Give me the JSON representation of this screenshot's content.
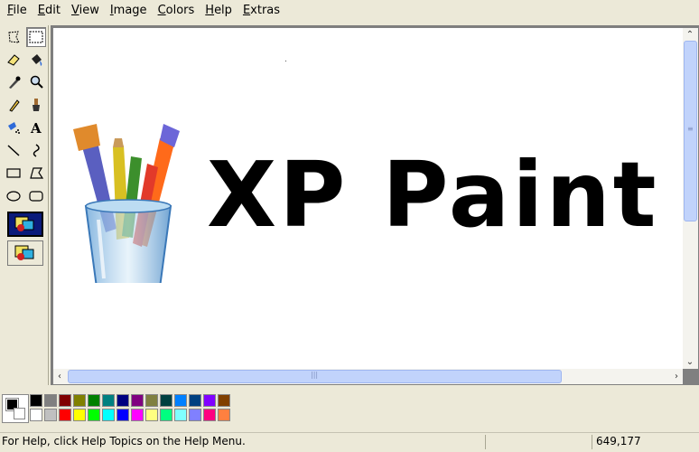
{
  "menu": [
    {
      "label": "File",
      "accel": "F",
      "rest": "ile"
    },
    {
      "label": "Edit",
      "accel": "E",
      "rest": "dit"
    },
    {
      "label": "View",
      "accel": "V",
      "rest": "iew"
    },
    {
      "label": "Image",
      "accel": "I",
      "rest": "mage"
    },
    {
      "label": "Colors",
      "accel": "C",
      "rest": "olors"
    },
    {
      "label": "Help",
      "accel": "H",
      "rest": "elp"
    },
    {
      "label": "Extras",
      "accel": "E",
      "rest": "xtras"
    }
  ],
  "tools": [
    "free-form-select-icon",
    "select-icon",
    "eraser-icon",
    "fill-bucket-icon",
    "color-picker-icon",
    "magnifier-icon",
    "pencil-icon",
    "brush-icon",
    "airbrush-icon",
    "text-icon",
    "line-icon",
    "curve-icon",
    "rectangle-icon",
    "polygon-icon",
    "ellipse-icon",
    "rounded-rectangle-icon"
  ],
  "selected_tool": "select-icon",
  "canvas": {
    "headline": "XP Paint",
    "logo": "paint-brushes-cup-logo"
  },
  "palette": {
    "foreground": "#000000",
    "background": "#ffffff",
    "row1": [
      "#000000",
      "#808080",
      "#800000",
      "#808000",
      "#008000",
      "#008080",
      "#000080",
      "#800080",
      "#808040",
      "#004040",
      "#0080ff",
      "#004080",
      "#8000ff",
      "#804000"
    ],
    "row2": [
      "#ffffff",
      "#c0c0c0",
      "#ff0000",
      "#ffff00",
      "#00ff00",
      "#00ffff",
      "#0000ff",
      "#ff00ff",
      "#ffff80",
      "#00ff80",
      "#80ffff",
      "#8080ff",
      "#ff0080",
      "#ff8040"
    ]
  },
  "status": {
    "help_text": "For Help, click Help Topics on the Help Menu.",
    "coords": "649,177"
  }
}
